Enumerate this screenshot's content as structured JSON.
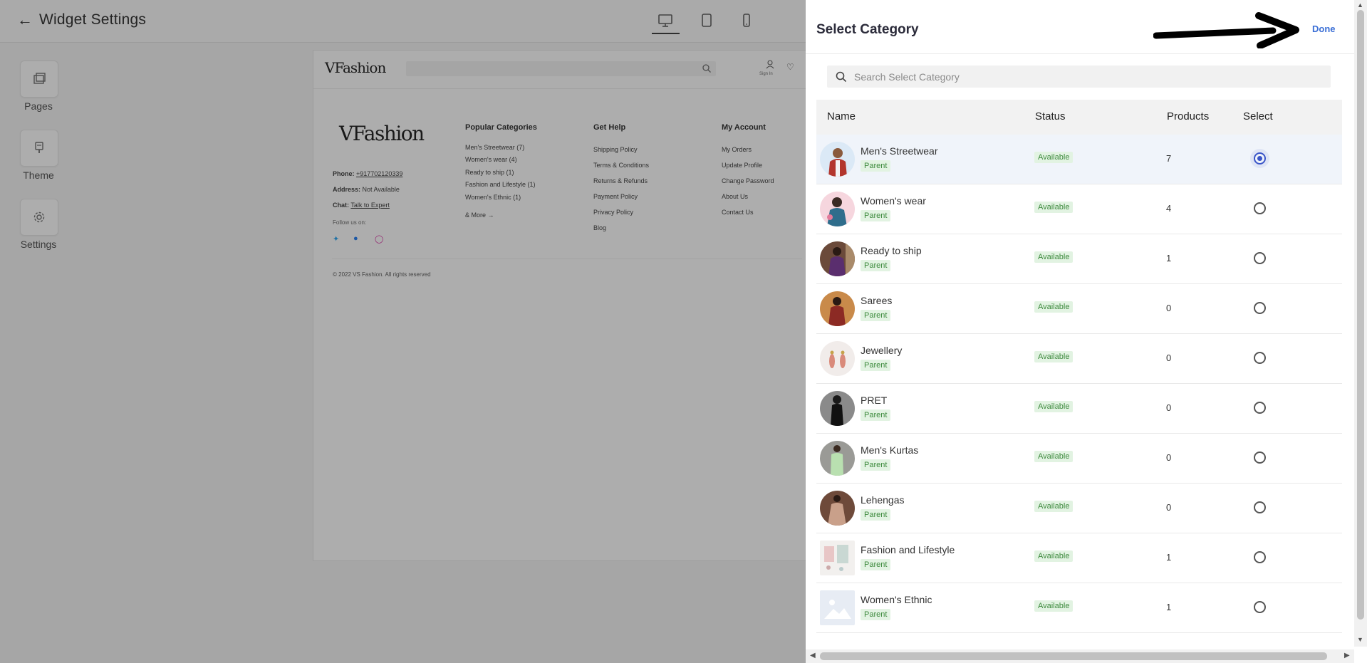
{
  "editor": {
    "title": "Widget Settings",
    "sidebar": [
      {
        "label": "Pages",
        "icon": "pages-icon"
      },
      {
        "label": "Theme",
        "icon": "theme-icon"
      },
      {
        "label": "Settings",
        "icon": "settings-gear-icon"
      }
    ],
    "devices": [
      "desktop-icon",
      "tablet-icon",
      "mobile-icon"
    ]
  },
  "preview": {
    "logo": "VFashion",
    "signin": "Sign In",
    "footer_logo": "VFashion",
    "phone_label": "Phone:",
    "phone": "+917702120339",
    "address_label": "Address:",
    "address": "Not Available",
    "chat_label": "Chat:",
    "chat": "Talk to Expert",
    "follow": "Follow us on:",
    "copyright": "© 2022 VS Fashion. All rights reserved",
    "columns": [
      {
        "title": "Popular Categories",
        "items": [
          "Men's Streetwear (7)",
          "Women's wear (4)",
          "Ready to ship (1)",
          "Fashion and Lifestyle (1)",
          "Women's Ethnic (1)",
          "& More →"
        ]
      },
      {
        "title": "Get Help",
        "items": [
          "Shipping Policy",
          "Terms & Conditions",
          "Returns & Refunds",
          "Payment Policy",
          "Privacy Policy",
          "Blog"
        ]
      },
      {
        "title": "My Account",
        "items": [
          "My Orders",
          "Update Profile",
          "Change Password",
          "About Us",
          "Contact Us"
        ]
      }
    ]
  },
  "panel": {
    "title": "Select Category",
    "done": "Done",
    "search_placeholder": "Search Select Category",
    "headers": {
      "name": "Name",
      "status": "Status",
      "products": "Products",
      "select": "Select"
    },
    "rows": [
      {
        "name": "Men's Streetwear",
        "tag": "Parent",
        "status": "Available",
        "products": "7",
        "selected": true
      },
      {
        "name": "Women's wear",
        "tag": "Parent",
        "status": "Available",
        "products": "4",
        "selected": false
      },
      {
        "name": "Ready to ship",
        "tag": "Parent",
        "status": "Available",
        "products": "1",
        "selected": false
      },
      {
        "name": "Sarees",
        "tag": "Parent",
        "status": "Available",
        "products": "0",
        "selected": false
      },
      {
        "name": "Jewellery",
        "tag": "Parent",
        "status": "Available",
        "products": "0",
        "selected": false
      },
      {
        "name": "PRET",
        "tag": "Parent",
        "status": "Available",
        "products": "0",
        "selected": false
      },
      {
        "name": "Men's Kurtas",
        "tag": "Parent",
        "status": "Available",
        "products": "0",
        "selected": false
      },
      {
        "name": "Lehengas",
        "tag": "Parent",
        "status": "Available",
        "products": "0",
        "selected": false
      },
      {
        "name": "Fashion and Lifestyle",
        "tag": "Parent",
        "status": "Available",
        "products": "1",
        "selected": false
      },
      {
        "name": "Women's Ethnic",
        "tag": "Parent",
        "status": "Available",
        "products": "1",
        "selected": false
      }
    ]
  },
  "colors": {
    "accent": "#3b6fd6",
    "radio_selected": "#3a55c8",
    "badge_bg": "#e2f3e2",
    "badge_text": "#3d8a3d"
  }
}
